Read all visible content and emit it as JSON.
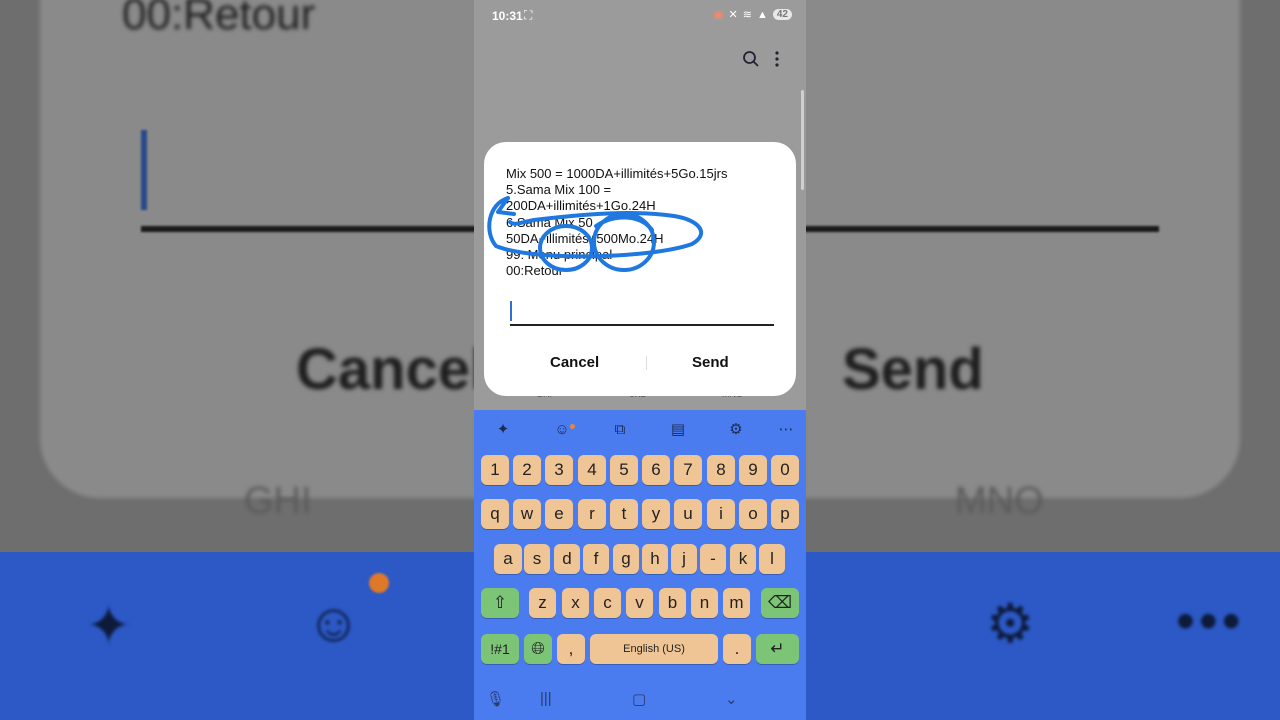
{
  "background": {
    "retour_text": "00:Retour",
    "cancel_text": "Cancel",
    "send_text": "Send",
    "ghi_text": "GHI",
    "mno_text": "MNO"
  },
  "status_bar": {
    "time": "10:31",
    "battery": "42"
  },
  "peek_labels": {
    "ghi": "GHI",
    "jkl": "JKL",
    "mno": "MNO"
  },
  "dialog": {
    "lines": [
      "Mix 500 = 1000DA+illimités+5Go.15jrs",
      "5.Sama Mix 100 =",
      "200DA+illimités+1Go.24H",
      "6.Sama Mix 50",
      "50DA+illimités+500Mo.24H",
      "99: Menu principal",
      "00:Retour"
    ],
    "input_value": "",
    "cancel_label": "Cancel",
    "send_label": "Send"
  },
  "keyboard": {
    "number_row": [
      "1",
      "2",
      "3",
      "4",
      "5",
      "6",
      "7",
      "8",
      "9",
      "0"
    ],
    "row1": [
      "q",
      "w",
      "e",
      "r",
      "t",
      "y",
      "u",
      "i",
      "o",
      "p"
    ],
    "row2": [
      "a",
      "s",
      "d",
      "f",
      "g",
      "h",
      "j",
      "-",
      "k",
      "l"
    ],
    "row3": [
      "z",
      "x",
      "c",
      "v",
      "b",
      "n",
      "m"
    ],
    "symbols_label": "!#1",
    "comma_label": ",",
    "space_label": "English (US)",
    "period_label": ".",
    "colors": {
      "body": "#4a7cf0",
      "key": "#f0c595",
      "action_key": "#7cc576"
    }
  },
  "annotation": {
    "color": "#1e78e0"
  }
}
